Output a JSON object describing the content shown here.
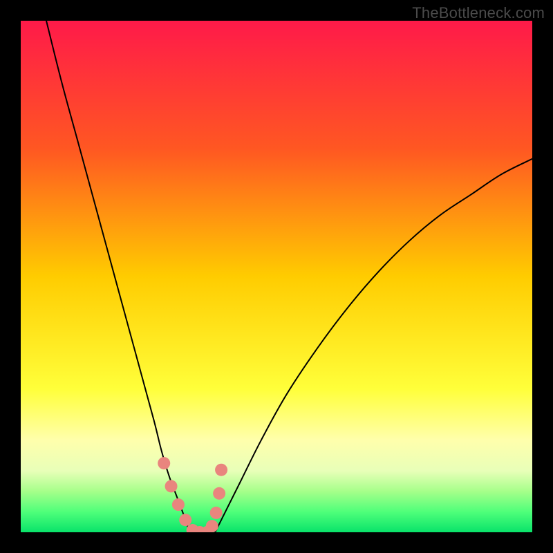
{
  "watermark": "TheBottleneck.com",
  "chart_data": {
    "type": "line",
    "title": "",
    "xlabel": "",
    "ylabel": "",
    "xlim": [
      0,
      100
    ],
    "ylim": [
      0,
      100
    ],
    "background_gradient": {
      "stops": [
        {
          "offset": 0.0,
          "color": "#ff1a49"
        },
        {
          "offset": 0.25,
          "color": "#ff5722"
        },
        {
          "offset": 0.5,
          "color": "#ffcc00"
        },
        {
          "offset": 0.72,
          "color": "#ffff3a"
        },
        {
          "offset": 0.82,
          "color": "#ffffac"
        },
        {
          "offset": 0.88,
          "color": "#e8ffb8"
        },
        {
          "offset": 0.92,
          "color": "#a6ff8a"
        },
        {
          "offset": 0.96,
          "color": "#4fff7a"
        },
        {
          "offset": 1.0,
          "color": "#09e36a"
        }
      ]
    },
    "series": [
      {
        "name": "left-curve",
        "type": "line",
        "color": "#000000",
        "width": 2,
        "x": [
          5,
          8,
          11,
          14,
          17,
          20,
          23,
          26,
          27.5,
          29,
          30.5,
          32,
          33
        ],
        "y": [
          100,
          88,
          77,
          66,
          55,
          44,
          33,
          22,
          16,
          11,
          7,
          3,
          0
        ]
      },
      {
        "name": "right-curve",
        "type": "line",
        "color": "#000000",
        "width": 2,
        "x": [
          38,
          40,
          43,
          47,
          52,
          58,
          64,
          70,
          76,
          82,
          88,
          94,
          100
        ],
        "y": [
          0,
          4,
          10,
          18,
          27,
          36,
          44,
          51,
          57,
          62,
          66,
          70,
          73
        ]
      },
      {
        "name": "valley-markers",
        "type": "scatter",
        "color": "#e9857e",
        "radius": 9,
        "x": [
          28.0,
          29.4,
          30.8,
          32.2,
          33.6,
          35.0,
          36.4,
          37.4,
          38.2,
          38.8,
          39.2
        ],
        "y": [
          13.5,
          9.0,
          5.4,
          2.4,
          0.4,
          0.0,
          0.0,
          1.2,
          3.8,
          7.6,
          12.2
        ]
      }
    ]
  }
}
